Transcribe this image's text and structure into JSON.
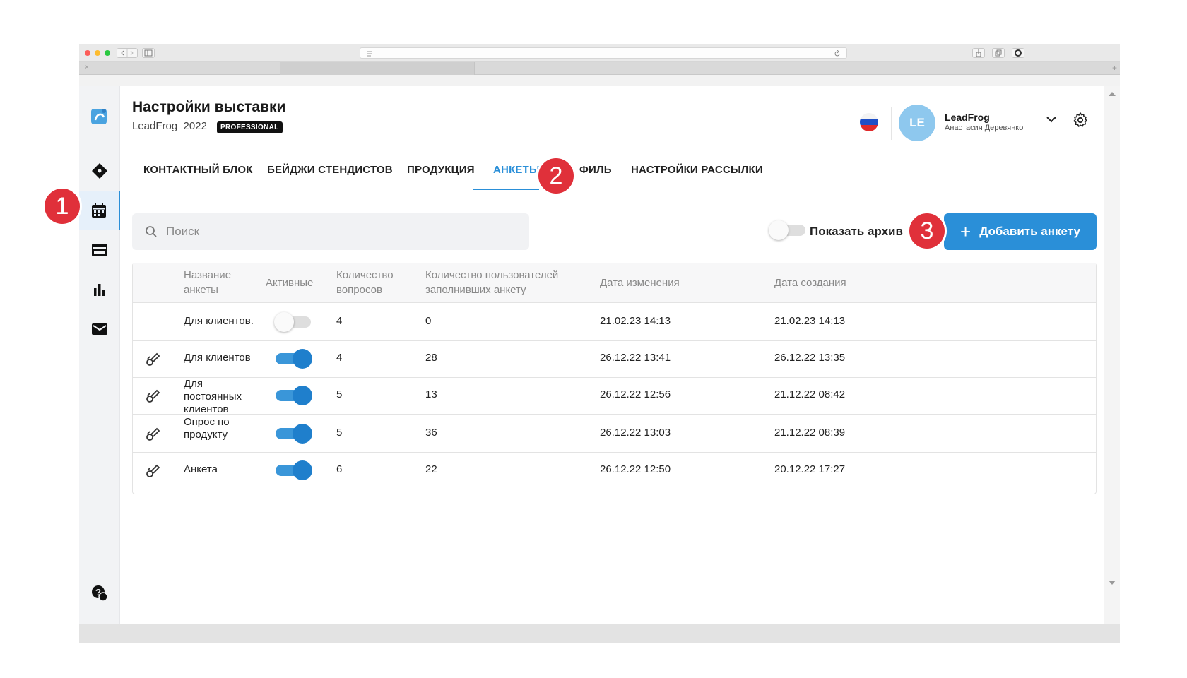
{
  "browser": {
    "traffic_colors": [
      "#fc5d58",
      "#fdbb2d",
      "#2ac840"
    ],
    "tab_close": "×",
    "new_tab": "+"
  },
  "sidebar": {
    "items": [
      {
        "icon": "logo-icon"
      },
      {
        "icon": "ticket-icon"
      },
      {
        "icon": "calendar-icon",
        "active": true
      },
      {
        "icon": "card-icon"
      },
      {
        "icon": "bar-chart-icon"
      },
      {
        "icon": "mail-icon"
      },
      {
        "icon": "help-chat-icon"
      }
    ]
  },
  "header": {
    "title": "Настройки выставки",
    "subtitle": "LeadFrog_2022",
    "badge": "PROFESSIONAL",
    "avatar_initials": "LE",
    "user_name": "LeadFrog",
    "user_fullname": "Анастасия Деревянко"
  },
  "tabs": [
    {
      "label": "КОНТАКТНЫЙ БЛОК"
    },
    {
      "label": "БЕЙДЖИ СТЕНДИСТОВ"
    },
    {
      "label": "ПРОДУКЦИЯ"
    },
    {
      "label": "АНКЕТЫ",
      "active": true
    },
    {
      "label": "ФИЛЬ"
    },
    {
      "label": "НАСТРОЙКИ РАССЫЛКИ"
    }
  ],
  "toolbar": {
    "search_placeholder": "Поиск",
    "archive_label": "Показать архив",
    "archive_on": false,
    "add_button": "Добавить анкету",
    "add_plus": "+"
  },
  "table": {
    "headers": {
      "name": "Название анкеты",
      "active": "Активные",
      "questions": "Количество вопросов",
      "users": "Количество пользователей заполнивших анкету",
      "modified": "Дата изменения",
      "created": "Дата создания"
    },
    "rows": [
      {
        "name": "Для клиентов.",
        "active": false,
        "editable": false,
        "questions": "4",
        "users": "0",
        "modified": "21.02.23 14:13",
        "created": "21.02.23 14:13"
      },
      {
        "name": "Для клиентов",
        "active": true,
        "editable": true,
        "questions": "4",
        "users": "28",
        "modified": "26.12.22 13:41",
        "created": "26.12.22 13:35"
      },
      {
        "name": "Для постоянных клиентов",
        "active": true,
        "editable": true,
        "questions": "5",
        "users": "13",
        "modified": "26.12.22 12:56",
        "created": "21.12.22 08:42"
      },
      {
        "name": "Опрос по продукту",
        "active": true,
        "editable": true,
        "questions": "5",
        "users": "36",
        "modified": "26.12.22 13:03",
        "created": "21.12.22 08:39"
      },
      {
        "name": "Анкета",
        "active": true,
        "editable": true,
        "questions": "6",
        "users": "22",
        "modified": "26.12.22 12:50",
        "created": "20.12.22 17:27"
      }
    ]
  },
  "markers": [
    "1",
    "2",
    "3"
  ],
  "colors": {
    "accent": "#2a8fd8",
    "marker": "#e0303a"
  }
}
